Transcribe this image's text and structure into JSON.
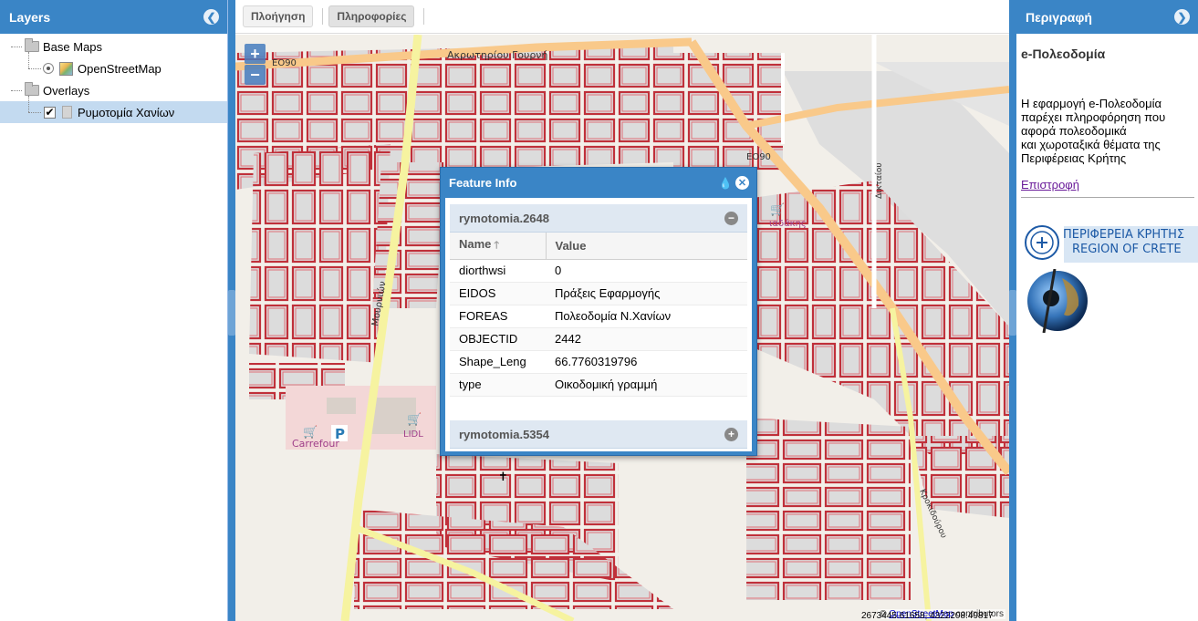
{
  "layers_panel": {
    "title": "Layers",
    "tree": {
      "base_maps": "Base Maps",
      "osm": "OpenStreetMap",
      "overlays": "Overlays",
      "ryth": "Ρυμοτομία Χανίων"
    }
  },
  "toolbar": {
    "nav_label": "Πλοήγηση",
    "info_label": "Πληροφορίες"
  },
  "map": {
    "zoom_in": "+",
    "zoom_out": "−",
    "labels": {
      "eo90_a": "ΕΟ90",
      "eo90_b": "ΕΟ90",
      "street_top": "Ακρωτηρίου Γουρνή",
      "street_mournion": "Μουρνιών",
      "street_dikt": "Δικταίου",
      "street_krok": "Κροκιδούρου",
      "carrefour": "Carrefour",
      "lidl": "LIDL",
      "shop": "ιαδάκης",
      "parking": "P"
    },
    "attribution_prefix": "©",
    "attribution_link": "OpenStreetMap",
    "attribution_suffix": "contributors",
    "coords": "2673445.61658, 4322208.49817"
  },
  "popup": {
    "title": "Feature Info",
    "feature1_title": "rymotomia.2648",
    "feature2_title": "rymotomia.5354",
    "col_name": "Name",
    "col_value": "Value",
    "rows": [
      {
        "name": "diorthwsi",
        "value": "0"
      },
      {
        "name": "EIDOS",
        "value": "Πράξεις Εφαρμογής"
      },
      {
        "name": "FOREAS",
        "value": "Πολεοδομία Ν.Χανίων"
      },
      {
        "name": "OBJECTID",
        "value": "2442"
      },
      {
        "name": "Shape_Leng",
        "value": "66.7760319796"
      },
      {
        "name": "type",
        "value": "Οικοδομική γραμμή"
      }
    ]
  },
  "right_panel": {
    "title": "Περιγραφή",
    "app_name": "e-Πολεοδομία",
    "line1": "Η εφαρμογή e-Πολεοδομία",
    "line2": "παρέχει πληροφόρηση που",
    "line3": "αφορά πολεοδομικά",
    "line4": "και χωροταξικά θέματα της",
    "line5": "Περιφέρειας Κρήτης",
    "back_link": "Επιστροφή",
    "logo_gr": "ΠΕΡΙΦΕΡΕΙΑ ΚΡΗΤΗΣ",
    "logo_en": "REGION OF CRETE"
  },
  "colors": {
    "header_blue": "#3a85c6",
    "block_outline": "#c0303a",
    "road_yellow": "#f6f3a0",
    "road_orange": "#f9c98a"
  }
}
